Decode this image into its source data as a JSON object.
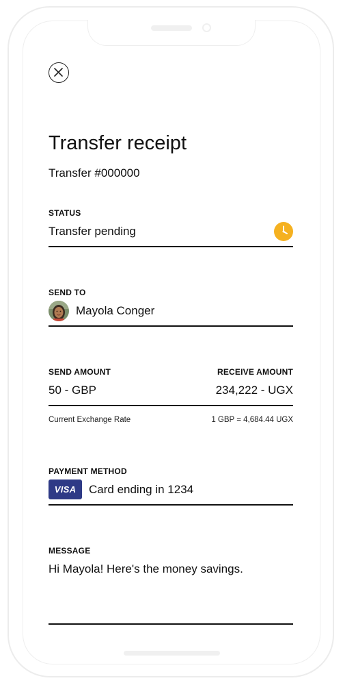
{
  "header": {
    "title": "Transfer receipt",
    "transfer_number": "Transfer #000000"
  },
  "status": {
    "label": "STATUS",
    "value": "Transfer pending",
    "icon": "clock-icon",
    "icon_color": "#f5b120"
  },
  "recipient": {
    "label": "SEND TO",
    "name": "Mayola Conger"
  },
  "amounts": {
    "send_label": "SEND AMOUNT",
    "send_value": "50 - GBP",
    "receive_label": "RECEIVE AMOUNT",
    "receive_value": "234,222 - UGX",
    "rate_label": "Current Exchange Rate",
    "rate_value": "1 GBP = 4,684.44 UGX"
  },
  "payment": {
    "label": "PAYMENT METHOD",
    "card_brand": "VISA",
    "card_text": "Card ending in 1234",
    "brand_color": "#2e3a86"
  },
  "message": {
    "label": "MESSAGE",
    "text": "Hi Mayola! Here's the money savings."
  }
}
